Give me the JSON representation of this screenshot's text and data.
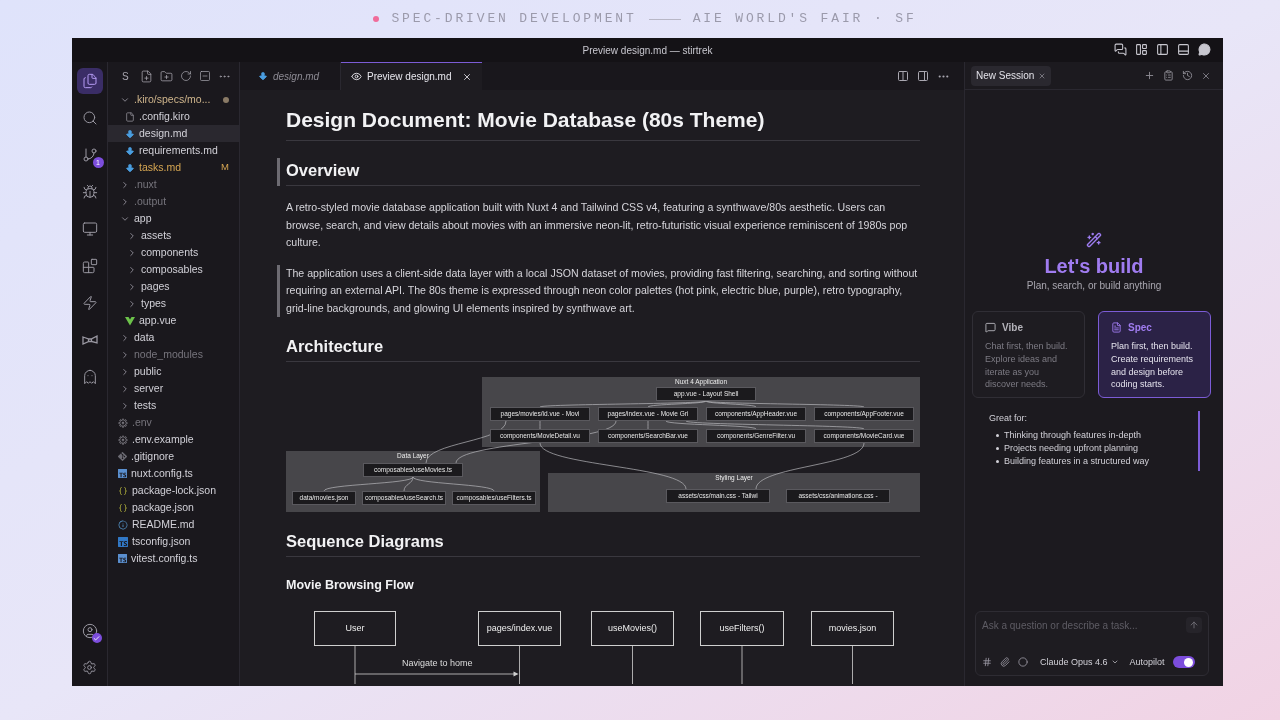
{
  "banner": {
    "left": "SPEC-DRIVEN DEVELOPMENT",
    "right": "AIE WORLD'S FAIR · SF"
  },
  "window": {
    "title": "Preview design.md — stirtrek"
  },
  "activity_bar": {
    "items": [
      {
        "kind": "explorer",
        "selected": true
      },
      {
        "kind": "search",
        "selected": false
      },
      {
        "kind": "source-control",
        "selected": false,
        "badge": "1"
      },
      {
        "kind": "debug",
        "selected": false
      },
      {
        "kind": "remote",
        "selected": false
      },
      {
        "kind": "extensions",
        "selected": false
      },
      {
        "kind": "power",
        "selected": false
      },
      {
        "kind": "bowtie",
        "selected": false
      },
      {
        "kind": "ghost",
        "selected": false
      }
    ],
    "bottom": [
      {
        "kind": "account",
        "verified": true
      },
      {
        "kind": "settings"
      }
    ]
  },
  "sidebar": {
    "title": "S",
    "tree": [
      {
        "label": ".kiro/specs/mo...",
        "kind": "folder",
        "expanded": true,
        "selected": false,
        "dimmed": false,
        "modified": true,
        "children": [
          {
            "label": ".config.kiro",
            "kind": "config",
            "selected": false,
            "dimmed": false,
            "modified": false
          },
          {
            "label": "design.md",
            "kind": "markdown",
            "selected": true,
            "dimmed": false,
            "modified": false
          },
          {
            "label": "requirements.md",
            "kind": "markdown",
            "selected": false,
            "dimmed": false,
            "modified": false
          },
          {
            "label": "tasks.md",
            "kind": "markdown",
            "selected": false,
            "dimmed": false,
            "modified": true,
            "badge": "M"
          }
        ]
      },
      {
        "label": ".nuxt",
        "kind": "folder",
        "expanded": false,
        "selected": false,
        "dimmed": true,
        "modified": false
      },
      {
        "label": ".output",
        "kind": "folder",
        "expanded": false,
        "selected": false,
        "dimmed": true,
        "modified": false
      },
      {
        "label": "app",
        "kind": "folder",
        "expanded": true,
        "selected": false,
        "dimmed": false,
        "modified": false,
        "children": [
          {
            "label": "assets",
            "kind": "folder",
            "expanded": false,
            "selected": false,
            "dimmed": false,
            "modified": false
          },
          {
            "label": "components",
            "kind": "folder",
            "expanded": false,
            "selected": false,
            "dimmed": false,
            "modified": false
          },
          {
            "label": "composables",
            "kind": "folder",
            "expanded": false,
            "selected": false,
            "dimmed": false,
            "modified": false
          },
          {
            "label": "pages",
            "kind": "folder",
            "expanded": false,
            "selected": false,
            "dimmed": false,
            "modified": false
          },
          {
            "label": "types",
            "kind": "folder",
            "expanded": false,
            "selected": false,
            "dimmed": false,
            "modified": false
          },
          {
            "label": "app.vue",
            "kind": "vue",
            "selected": false,
            "dimmed": false,
            "modified": false
          }
        ]
      },
      {
        "label": "data",
        "kind": "folder",
        "expanded": false,
        "selected": false,
        "dimmed": false,
        "modified": false
      },
      {
        "label": "node_modules",
        "kind": "folder",
        "expanded": false,
        "selected": false,
        "dimmed": true,
        "modified": false
      },
      {
        "label": "public",
        "kind": "folder",
        "expanded": false,
        "selected": false,
        "dimmed": false,
        "modified": false
      },
      {
        "label": "server",
        "kind": "folder",
        "expanded": false,
        "selected": false,
        "dimmed": false,
        "modified": false
      },
      {
        "label": "tests",
        "kind": "folder",
        "expanded": false,
        "selected": false,
        "dimmed": false,
        "modified": false
      },
      {
        "label": ".env",
        "kind": "settings",
        "selected": false,
        "dimmed": true,
        "modified": false
      },
      {
        "label": ".env.example",
        "kind": "settings",
        "selected": false,
        "dimmed": false,
        "modified": false
      },
      {
        "label": ".gitignore",
        "kind": "git",
        "selected": false,
        "dimmed": false,
        "modified": false
      },
      {
        "label": "nuxt.config.ts",
        "kind": "ts",
        "selected": false,
        "dimmed": false,
        "modified": false
      },
      {
        "label": "package-lock.json",
        "kind": "json",
        "selected": false,
        "dimmed": false,
        "modified": false
      },
      {
        "label": "package.json",
        "kind": "json",
        "selected": false,
        "dimmed": false,
        "modified": false
      },
      {
        "label": "README.md",
        "kind": "info",
        "selected": false,
        "dimmed": false,
        "modified": false
      },
      {
        "label": "tsconfig.json",
        "kind": "tsconfig",
        "selected": false,
        "dimmed": false,
        "modified": false
      },
      {
        "label": "vitest.config.ts",
        "kind": "ts",
        "selected": false,
        "dimmed": false,
        "modified": false
      }
    ]
  },
  "editor": {
    "tabs": [
      {
        "label": "design.md",
        "kind": "markdown",
        "selected": false
      },
      {
        "label": "Preview design.md",
        "kind": "preview",
        "selected": true
      }
    ],
    "blocks": [
      {
        "kind": "h1",
        "text": "Design Document: Movie Database (80s Theme)",
        "highlighted": false
      },
      {
        "kind": "h2",
        "text": "Overview",
        "highlighted": true
      },
      {
        "kind": "p",
        "text": "A retro-styled movie database application built with Nuxt 4 and Tailwind CSS v4, featuring a synthwave/80s aesthetic. Users can browse, search, and view details about movies with an immersive neon-lit, retro-futuristic visual experience reminiscent of 1980s pop culture.",
        "highlighted": false
      },
      {
        "kind": "p",
        "text": "The application uses a client-side data layer with a local JSON dataset of movies, providing fast filtering, searching, and sorting without requiring an external API. The 80s theme is expressed through neon color palettes (hot pink, electric blue, purple), retro typography, grid-line backgrounds, and glowing UI elements inspired by synthwave art.",
        "highlighted": true
      },
      {
        "kind": "h2",
        "text": "Architecture",
        "highlighted": false
      },
      {
        "kind": "flowchart",
        "highlighted": false,
        "groups": [
          {
            "title": "Nuxt 4 Application",
            "nodes": [
              {
                "label": "app.vue - Layout Shell"
              },
              {
                "label": "pages/movies/id.vue - Movi"
              },
              {
                "label": "pages/index.vue - Movie Gri"
              },
              {
                "label": "components/AppHeader.vue"
              },
              {
                "label": "components/AppFooter.vue"
              },
              {
                "label": "components/MovieDetail.vu"
              },
              {
                "label": "components/SearchBar.vue"
              },
              {
                "label": "components/GenreFilter.vu"
              },
              {
                "label": "components/MovieCard.vue"
              }
            ]
          },
          {
            "title": "Data Layer",
            "nodes": [
              {
                "label": "composables/useMovies.ts"
              },
              {
                "label": "data/movies.json"
              },
              {
                "label": "composables/useSearch.ts"
              },
              {
                "label": "composables/useFilters.ts"
              }
            ]
          },
          {
            "title": "Styling Layer",
            "nodes": [
              {
                "label": "assets/css/main.css - Tailwi"
              },
              {
                "label": "assets/css/animations.css -"
              }
            ]
          }
        ]
      },
      {
        "kind": "h2",
        "text": "Sequence Diagrams",
        "highlighted": false
      },
      {
        "kind": "h3",
        "text": "Movie Browsing Flow",
        "highlighted": false
      },
      {
        "kind": "sequence",
        "highlighted": false,
        "participants": [
          {
            "label": "User"
          },
          {
            "label": "pages/index.vue"
          },
          {
            "label": "useMovies()"
          },
          {
            "label": "useFilters()"
          },
          {
            "label": "movies.json"
          }
        ],
        "messages": [
          {
            "label": "Navigate to home"
          }
        ]
      }
    ]
  },
  "chat": {
    "tab": "New Session",
    "heading": "Let's build",
    "subtitle": "Plan, search, or build anything",
    "modes": [
      {
        "kind": "vibe",
        "title": "Vibe",
        "description": "Chat first, then build. Explore ideas and iterate as you discover needs.",
        "selected": false
      },
      {
        "kind": "spec",
        "title": "Spec",
        "description": "Plan first, then build. Create requirements and design before coding starts.",
        "selected": true
      }
    ],
    "great_for": {
      "title": "Great for:",
      "items": [
        "Thinking through features in-depth",
        "Projects needing upfront planning",
        "Building features in a structured way"
      ]
    },
    "input": {
      "placeholder": "Ask a question or describe a task...",
      "model": "Claude Opus 4.6",
      "autopilot": {
        "label": "Autopilot",
        "on": true
      }
    }
  }
}
